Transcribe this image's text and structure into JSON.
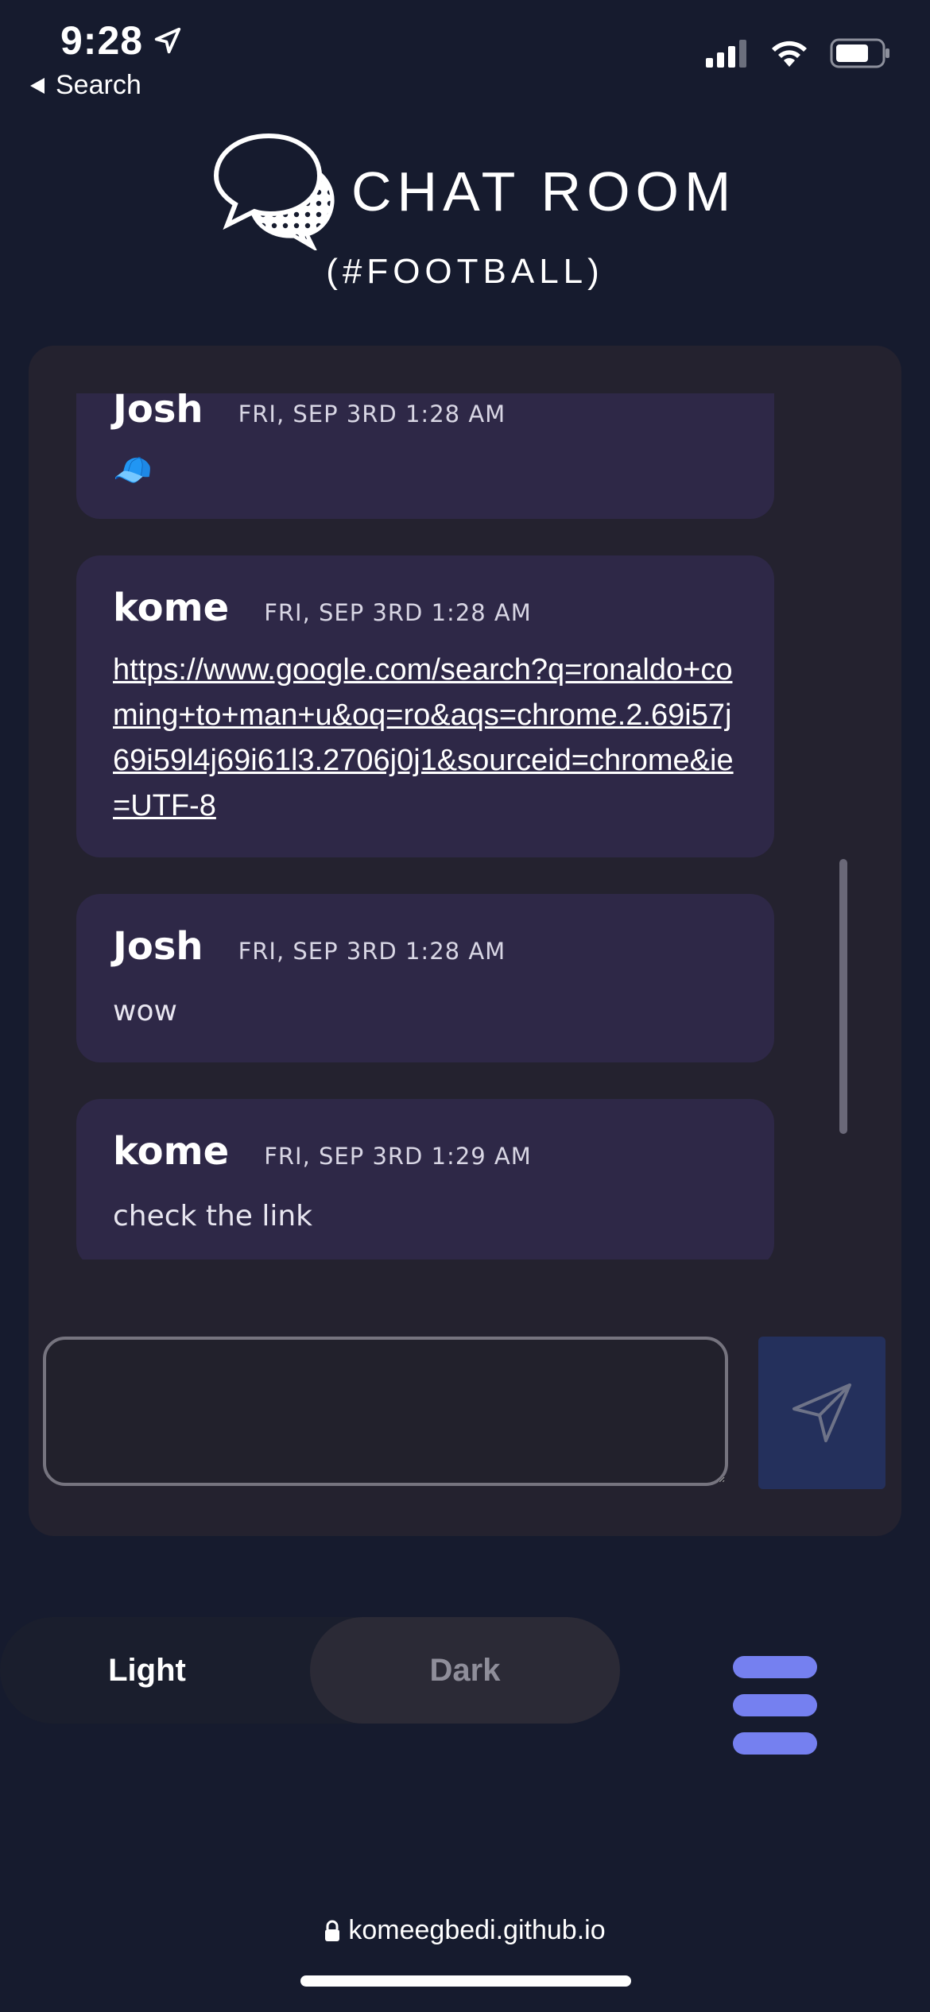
{
  "status_bar": {
    "time": "9:28",
    "back_label": "Search"
  },
  "header": {
    "title": "CHAT ROOM",
    "channel": "(#FOOTBALL)"
  },
  "messages": [
    {
      "author": "Josh",
      "time": "FRI, SEP 3RD 1:28 AM",
      "text": "🧢",
      "kind": "emoji"
    },
    {
      "author": "kome",
      "time": "FRI, SEP 3RD 1:28 AM",
      "text": "https://www.google.com/search?q=ronaldo+coming+to+man+u&oq=ro&aqs=chrome.2.69i57j69i59l4j69i61l3.2706j0j1&sourceid=chrome&ie=UTF-8",
      "kind": "link"
    },
    {
      "author": "Josh",
      "time": "FRI, SEP 3RD 1:28 AM",
      "text": "wow",
      "kind": "text"
    },
    {
      "author": "kome",
      "time": "FRI, SEP 3RD 1:29 AM",
      "text": "check the link",
      "kind": "text"
    }
  ],
  "composer": {
    "value": "",
    "send_icon": "paper-plane-icon"
  },
  "theme_toggle": {
    "light_label": "Light",
    "dark_label": "Dark",
    "selected": "Dark"
  },
  "menu": {
    "icon": "hamburger-menu-icon"
  },
  "browser": {
    "url": "komeegbedi.github.io"
  },
  "colors": {
    "background": "#161b2e",
    "panel": "#24222f",
    "bubble": "#2e2847",
    "accent": "#7580f0",
    "send_button": "#24305c"
  }
}
